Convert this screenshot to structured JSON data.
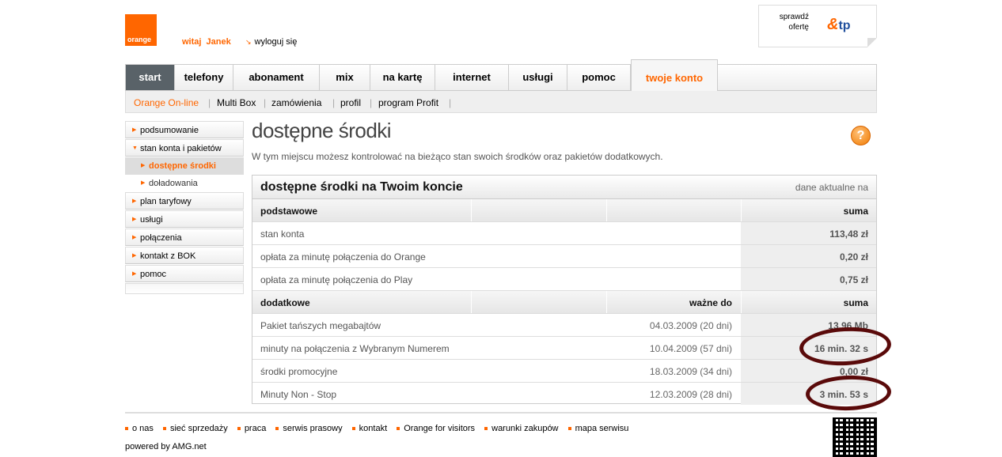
{
  "header": {
    "logo_text": "orange",
    "greeting": "witaj  Janek",
    "logout": "wyloguj się",
    "promo_line1": "sprawdź",
    "promo_line2": "ofertę",
    "tp_logo": "tp"
  },
  "nav": {
    "tabs": [
      "start",
      "telefony",
      "abonament",
      "mix",
      "na kartę",
      "internet",
      "usługi",
      "pomoc",
      "twoje konto"
    ],
    "active": "twoje konto"
  },
  "subnav": {
    "items": [
      "Orange On-line",
      "Multi Box",
      "zamówienia",
      "profil",
      "program Profit"
    ],
    "active": "Orange On-line"
  },
  "sidebar": {
    "items": [
      {
        "label": "podsumowanie"
      },
      {
        "label": "stan konta i pakietów"
      },
      {
        "label": "dostępne środki"
      },
      {
        "label": "doładowania"
      },
      {
        "label": "plan taryfowy"
      },
      {
        "label": "usługi"
      },
      {
        "label": "połączenia"
      },
      {
        "label": "kontakt z BOK"
      },
      {
        "label": "pomoc"
      }
    ]
  },
  "main": {
    "title": "dostępne środki",
    "help_icon": "?",
    "intro": "W tym miejscu możesz kontrolować na bieżąco stan swoich środków oraz pakietów dodatkowych.",
    "panel_title": "dostępne środki na Twoim koncie",
    "panel_date": "dane aktualne na",
    "basic_header": [
      "podstawowe",
      "suma"
    ],
    "basic_rows": [
      {
        "name": "stan konta",
        "value": "113,48 zł"
      },
      {
        "name": "opłata za minutę połączenia do Orange",
        "value": "0,20 zł"
      },
      {
        "name": "opłata za minutę połączenia do Play",
        "value": "0,75 zł"
      }
    ],
    "extra_header": [
      "dodatkowe",
      "ważne do",
      "suma"
    ],
    "extra_rows": [
      {
        "name": "Pakiet tańszych megabajtów",
        "valid": "04.03.2009 (20 dni)",
        "value": "13,96 Mb"
      },
      {
        "name": "minuty na połączenia z Wybranym Numerem",
        "valid": "10.04.2009 (57 dni)",
        "value": "16 min. 32 s"
      },
      {
        "name": "środki promocyjne",
        "valid": "18.03.2009 (34 dni)",
        "value": "0,00 zł"
      },
      {
        "name": "Minuty Non - Stop",
        "valid": "12.03.2009 (28 dni)",
        "value": "3 min. 53 s"
      }
    ]
  },
  "footer": {
    "links": [
      "o nas",
      "sieć sprzedaży",
      "praca",
      "serwis prasowy",
      "kontakt",
      "Orange for visitors",
      "warunki zakupów",
      "mapa serwisu"
    ],
    "powered": "powered by AMG.net"
  },
  "colors": {
    "accent": "#ff6600",
    "start_tab": "#596268",
    "annotation": "#5a0a0a"
  }
}
